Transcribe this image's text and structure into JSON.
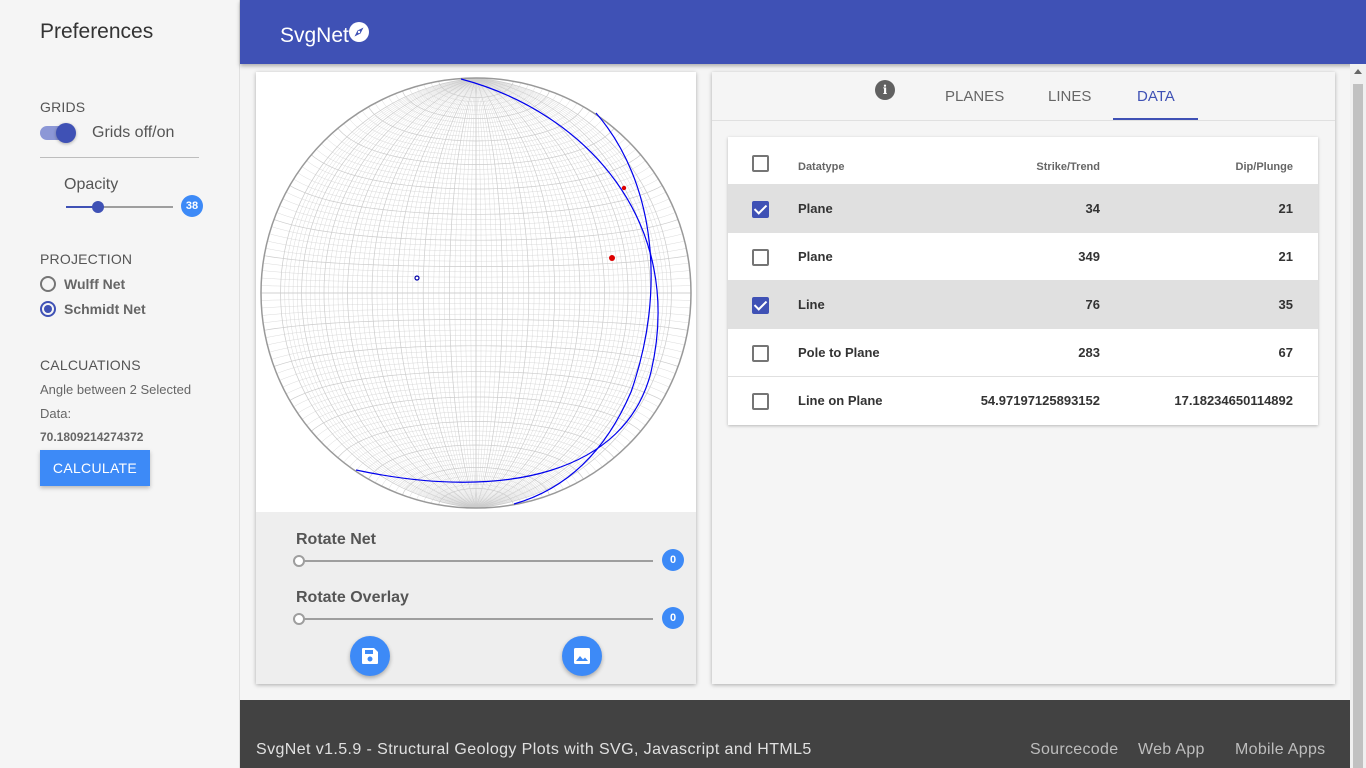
{
  "sidebar": {
    "title": "Preferences",
    "grids_heading": "GRIDS",
    "grids_toggle_label": "Grids off/on",
    "grids_on": true,
    "opacity_label": "Opacity",
    "opacity_value": "38",
    "opacity_fraction": 0.3,
    "projection_heading": "PROJECTION",
    "projection_options": [
      "Wulff Net",
      "Schmidt Net"
    ],
    "projection_selected": "Schmidt Net",
    "calculations_heading": "CALCUATIONS",
    "calc_desc_line1": "Angle between 2 Selected",
    "calc_desc_line2": "Data:",
    "calc_result": "70.1809214274372",
    "calc_button": "CALCULATE"
  },
  "header": {
    "brand": "SvgNet",
    "brand_icon": "compass-icon"
  },
  "plot": {
    "rotate_net_label": "Rotate Net",
    "rotate_net_value": "0",
    "rotate_overlay_label": "Rotate Overlay",
    "rotate_overlay_value": "0",
    "save_icon": "save-icon",
    "image_icon": "image-icon",
    "colors": {
      "plane": "#0000ee",
      "pole": "#dd0000",
      "line": "#0000aa",
      "grid": "#cccccc",
      "primitive": "#999999"
    }
  },
  "tabs": {
    "info_icon": "i",
    "items": [
      "PLANES",
      "LINES",
      "DATA"
    ],
    "active": "DATA"
  },
  "table": {
    "headers": {
      "datatype": "Datatype",
      "strike": "Strike/Trend",
      "dip": "Dip/Plunge"
    },
    "rows": [
      {
        "datatype": "Plane",
        "strike": "34",
        "dip": "21",
        "selected": true
      },
      {
        "datatype": "Plane",
        "strike": "349",
        "dip": "21",
        "selected": false
      },
      {
        "datatype": "Line",
        "strike": "76",
        "dip": "35",
        "selected": true
      },
      {
        "datatype": "Pole to Plane",
        "strike": "283",
        "dip": "67",
        "selected": false
      },
      {
        "datatype": "Line on Plane",
        "strike": "54.97197125893152",
        "dip": "17.18234650114892",
        "selected": false
      }
    ]
  },
  "footer": {
    "text": "SvgNet v1.5.9 - Structural Geology Plots with SVG, Javascript and HTML5",
    "links": [
      "Sourcecode",
      "Web App",
      "Mobile Apps"
    ]
  },
  "theme": {
    "primary": "#3f51b5",
    "accent": "#3d8af7",
    "footer_bg": "#424242"
  }
}
